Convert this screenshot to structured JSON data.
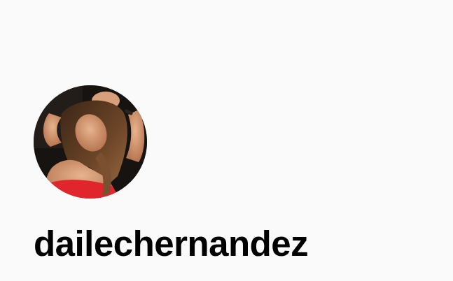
{
  "profile": {
    "username": "dailechernandez",
    "avatar_icon": "profile-photo"
  },
  "colors": {
    "background": "#fafafa",
    "username_text": "#000000"
  }
}
